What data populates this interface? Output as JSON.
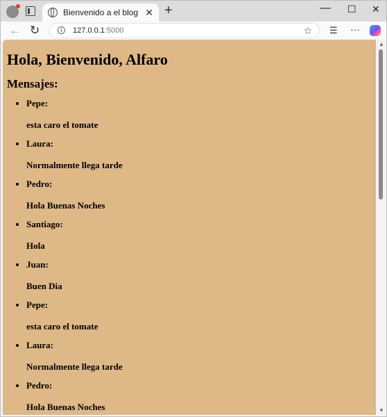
{
  "browser": {
    "tab_title": "Bienvenido a el blog",
    "url_host": "127.0.0.1",
    "url_port": ":5000"
  },
  "page": {
    "heading": "Hola, Bienvenido, Alfaro",
    "subheading": "Mensajes:",
    "messages": [
      {
        "author": "Pepe:",
        "text": "esta caro el tomate"
      },
      {
        "author": "Laura:",
        "text": "Normalmente llega tarde"
      },
      {
        "author": "Pedro:",
        "text": "Hola Buenas Noches"
      },
      {
        "author": "Santiago:",
        "text": "Hola"
      },
      {
        "author": "Juan:",
        "text": "Buen Dia"
      },
      {
        "author": "Pepe:",
        "text": "esta caro el tomate"
      },
      {
        "author": "Laura:",
        "text": "Normalmente llega tarde"
      },
      {
        "author": "Pedro:",
        "text": "Hola Buenas Noches"
      }
    ]
  },
  "icons": {
    "profile": "profile-icon",
    "tabs": "tab-actions-icon",
    "globe": "globe-icon",
    "close": "close-icon",
    "new_tab": "plus-icon",
    "back": "back-arrow-icon",
    "reload": "reload-icon",
    "info": "info-icon",
    "favorite": "star-icon",
    "favorites": "favorites-icon",
    "more": "more-icon",
    "copilot": "copilot-icon"
  },
  "colors": {
    "page_background": "#deb887"
  }
}
